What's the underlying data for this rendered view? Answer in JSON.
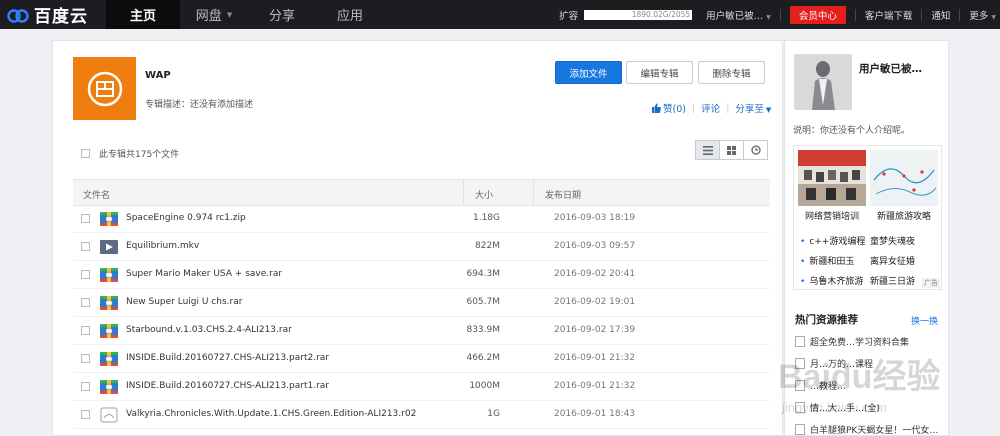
{
  "brand": {
    "name": "百度云"
  },
  "nav": {
    "items": [
      {
        "label": "主页",
        "active": true,
        "caret": false
      },
      {
        "label": "网盘",
        "active": false,
        "caret": true
      },
      {
        "label": "分享",
        "active": false,
        "caret": false
      },
      {
        "label": "应用",
        "active": false,
        "caret": false
      }
    ]
  },
  "topbar": {
    "quota_label": "扩容",
    "quota_value": "1890.02G/2055",
    "user": "用户敏已被…",
    "vip": "会员中心",
    "download": "客户端下载",
    "notify": "通知",
    "more": "更多"
  },
  "album": {
    "title": "WAP",
    "desc": "专辑描述：还没有添加描述",
    "add_btn": "添加文件",
    "edit_btn": "编辑专辑",
    "delete_btn": "删除专辑",
    "like": "赞(0)",
    "comment": "评论",
    "share": "分享至"
  },
  "file_count": "此专辑共175个文件",
  "table": {
    "col_name": "文件名",
    "col_size": "大小",
    "col_date": "发布日期",
    "rows": [
      {
        "name": "SpaceEngine 0.974 rc1.zip",
        "size": "1.18G",
        "date": "2016-09-03 18:19",
        "type": "archive"
      },
      {
        "name": "Equilibrium.mkv",
        "size": "822M",
        "date": "2016-09-03 09:57",
        "type": "video"
      },
      {
        "name": "Super Mario Maker USA + save.rar",
        "size": "694.3M",
        "date": "2016-09-02 20:41",
        "type": "archive"
      },
      {
        "name": "New Super Luigi U chs.rar",
        "size": "605.7M",
        "date": "2016-09-02 19:01",
        "type": "archive"
      },
      {
        "name": "Starbound.v.1.03.CHS.2.4-ALI213.rar",
        "size": "833.9M",
        "date": "2016-09-02 17:39",
        "type": "archive"
      },
      {
        "name": "INSIDE.Build.20160727.CHS-ALI213.part2.rar",
        "size": "466.2M",
        "date": "2016-09-01 21:32",
        "type": "archive"
      },
      {
        "name": "INSIDE.Build.20160727.CHS-ALI213.part1.rar",
        "size": "1000M",
        "date": "2016-09-01 21:32",
        "type": "archive"
      },
      {
        "name": "Valkyria.Chronicles.With.Update.1.CHS.Green.Edition-ALI213.r02",
        "size": "1G",
        "date": "2016-09-01 18:43",
        "type": "generic"
      }
    ]
  },
  "sidebar": {
    "username": "用户敏已被…",
    "desc": "说明：你还没有个人介绍呢。",
    "ad": {
      "cap1": "网络营销培训",
      "cap2": "新疆旅游攻略",
      "links": [
        "c++游戏编程",
        "童梦失魂夜",
        "新疆和田玉",
        "离异女征婚",
        "乌鲁木齐旅游",
        "新疆三日游"
      ],
      "tag": "广告"
    },
    "hot_title": "热门资源推荐",
    "hot_refresh": "换一换",
    "hot_items": [
      "超全免费…学习资料合集",
      "月…万的…课程",
      "…教程…",
      "情…大…手…(全)",
      "白羊腿狼PK天蝎女星！一代女…"
    ]
  },
  "watermark": {
    "text": "Baidu经验",
    "sub": "jingyan.baidu.com"
  }
}
